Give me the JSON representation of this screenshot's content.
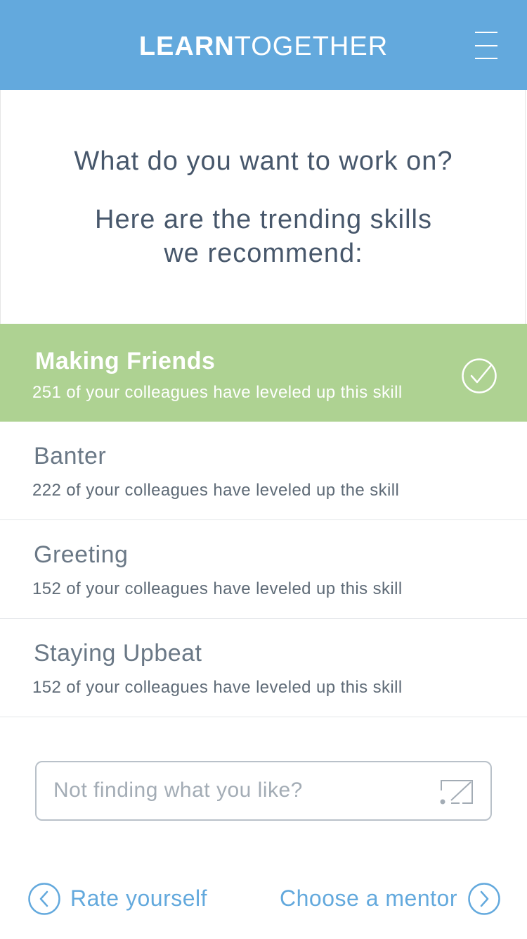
{
  "header": {
    "brand_bold": "LEARN",
    "brand_light": "TOGETHER",
    "menu_icon": "hamburger-menu-icon"
  },
  "intro": {
    "question": "What do you want to work on?",
    "subtext_line1": "Here are the trending skills",
    "subtext_line2": "we recommend:"
  },
  "skills": [
    {
      "name": "Making Friends",
      "description": "251 of your colleagues have leveled up this skill",
      "selected": true
    },
    {
      "name": "Banter",
      "description": "222 of your colleagues have leveled up the skill",
      "selected": false
    },
    {
      "name": "Greeting",
      "description": "152 of your colleagues have leveled up this skill",
      "selected": false
    },
    {
      "name": "Staying Upbeat",
      "description": "152 of your colleagues have leveled up this skill",
      "selected": false
    }
  ],
  "search": {
    "placeholder": "Not finding what you like?",
    "icon": "edit-icon"
  },
  "footer": {
    "left_label": "Rate yourself",
    "left_icon": "chevron-left-circle-icon",
    "right_label": "Choose a mentor",
    "right_icon": "chevron-right-circle-icon"
  },
  "colors": {
    "header_bg": "#63a9dd",
    "selected_bg": "#aed292",
    "text_primary": "#47576b",
    "link": "#63a9dd"
  }
}
